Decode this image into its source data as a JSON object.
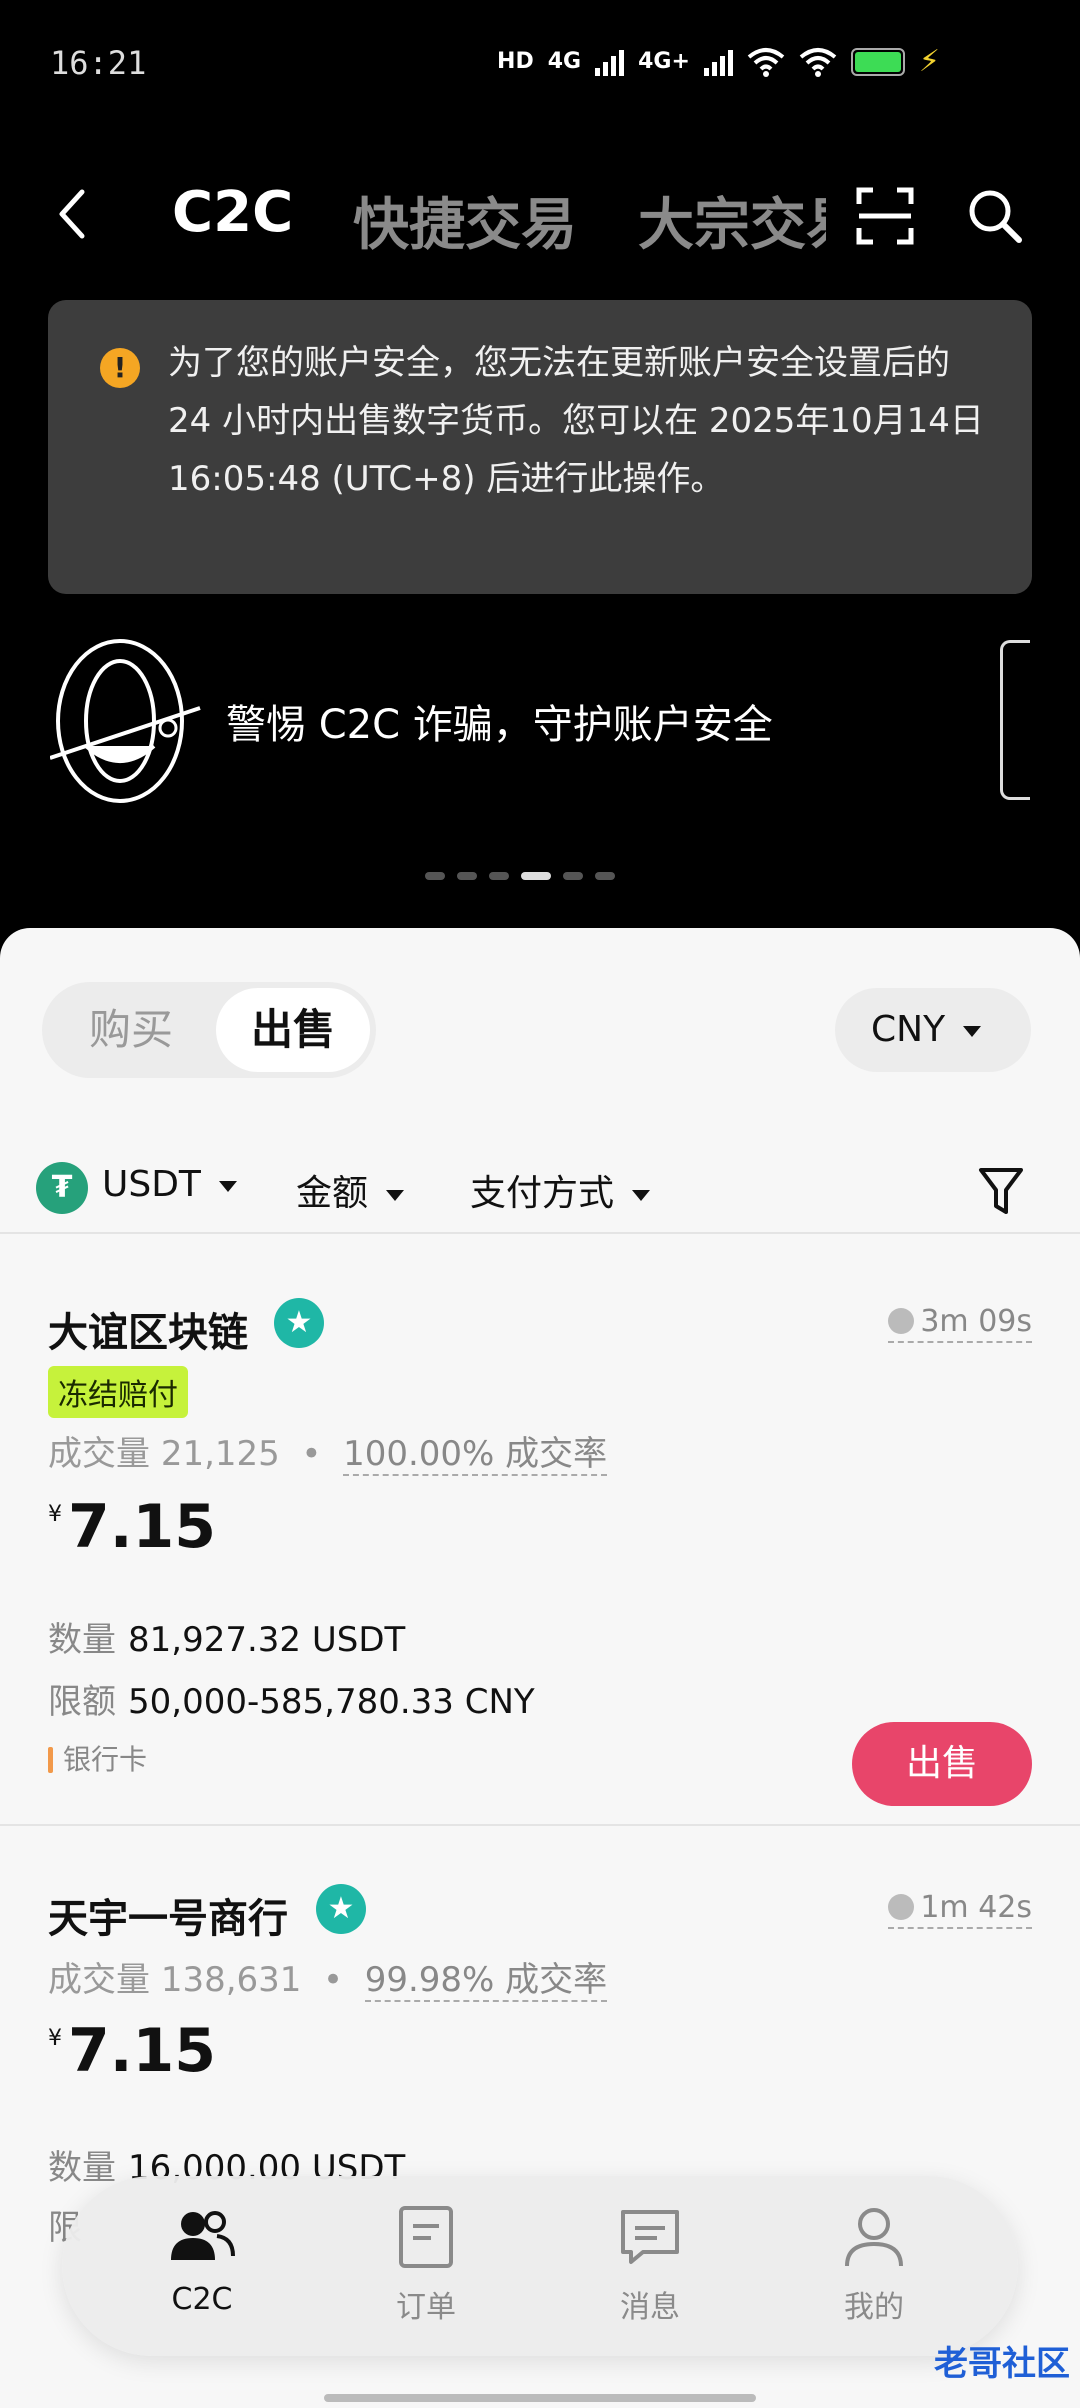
{
  "status_bar": {
    "time": "16:21",
    "hd_label": "HD",
    "net1": "4G",
    "net2": "4G+",
    "battery_color": "#3ddc55"
  },
  "header": {
    "tabs": [
      "C2C",
      "快捷交易",
      "大宗交易"
    ],
    "active_tab": "C2C",
    "icons": [
      "back-icon",
      "scan-icon",
      "search-icon"
    ]
  },
  "warning": {
    "icon": "warning-icon",
    "text": "为了您的账户安全，您无法在更新账户安全设置后的 24 小时内出售数字货币。您可以在 2025年10月14日 16:05:48 (UTC+8) 后进行此操作。"
  },
  "banner": {
    "text": "警惕 C2C 诈骗，守护账户安全",
    "active_page": 4,
    "page_count": 6
  },
  "trade": {
    "segments": [
      "购买",
      "出售"
    ],
    "active_segment": "出售",
    "currency": "CNY",
    "filters": {
      "coin": "USDT",
      "coin_icon_letter": "₮",
      "amount": "金额",
      "payment": "支付方式"
    }
  },
  "offers": [
    {
      "merchant": "大谊区块链",
      "timer": "3m 09s",
      "tag": "冻结赔付",
      "volume_label": "成交量",
      "volume": "21,125",
      "rate": "100.00% 成交率",
      "price_currency": "¥",
      "price": "7.15",
      "quantity_label": "数量",
      "quantity": "81,927.32 USDT",
      "limit_label": "限额",
      "limit": "50,000-585,780.33 CNY",
      "payment": "银行卡",
      "action": "出售"
    },
    {
      "merchant": "天宇一号商行",
      "timer": "1m 42s",
      "volume_label": "成交量",
      "volume": "138,631",
      "rate": "99.98% 成交率",
      "price_currency": "¥",
      "price": "7.15",
      "quantity_label": "数量",
      "quantity": "16,000.00 USDT",
      "limit_label": "限"
    }
  ],
  "bottom_nav": [
    {
      "label": "C2C",
      "icon": "people-icon",
      "active": true
    },
    {
      "label": "订单",
      "icon": "orders-icon",
      "active": false
    },
    {
      "label": "消息",
      "icon": "message-icon",
      "active": false
    },
    {
      "label": "我的",
      "icon": "profile-icon",
      "active": false
    }
  ],
  "watermark": "老哥社区"
}
